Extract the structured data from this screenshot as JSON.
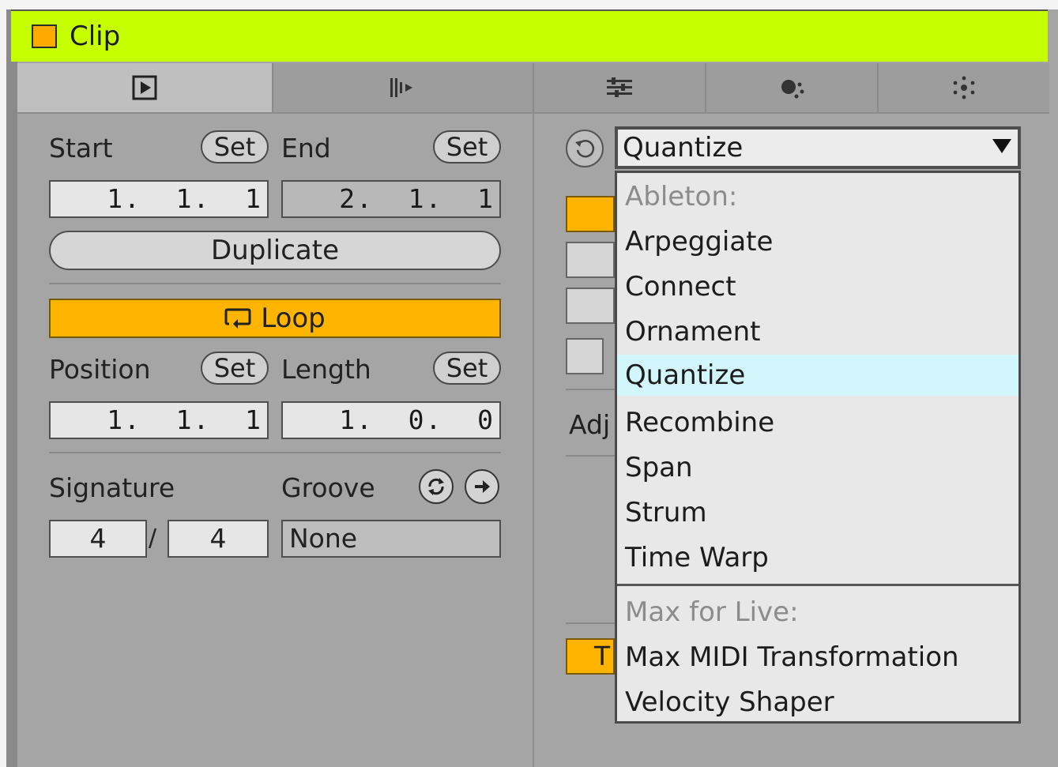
{
  "window": {
    "title": "Clip",
    "swatch_color": "#ffaa00",
    "title_bar_color": "#c5ff00"
  },
  "tabs": [
    {
      "icon": "play-box-icon",
      "active": true
    },
    {
      "icon": "audio-play-icon",
      "active": false
    },
    {
      "icon": "sliders-icon",
      "active": false
    },
    {
      "icon": "generators-icon",
      "active": false
    },
    {
      "icon": "transform-icon",
      "active": false
    }
  ],
  "left": {
    "start_label": "Start",
    "end_label": "End",
    "set_label": "Set",
    "start_value": "1.  1.  1",
    "end_value": "2.  1.  1",
    "duplicate_label": "Duplicate",
    "loop_label": "Loop",
    "position_label": "Position",
    "length_label": "Length",
    "position_value": "1.  1.  1",
    "length_value": "1.  0.  0",
    "signature_label": "Signature",
    "groove_label": "Groove",
    "sig_num": "4",
    "sig_slash": "/",
    "sig_den": "4",
    "groove_value": "None"
  },
  "right": {
    "device_select_value": "Quantize",
    "partial_label_adj": "Adj",
    "partial_button_t": "T",
    "dropdown": {
      "ableton_header": "Ableton:",
      "items": [
        "Arpeggiate",
        "Connect",
        "Ornament",
        "Quantize",
        "Recombine",
        "Span",
        "Strum",
        "Time Warp"
      ],
      "selected": "Quantize",
      "max_header": "Max for Live:",
      "max_items": [
        "Max MIDI Transformation",
        "Velocity Shaper"
      ]
    }
  },
  "colors": {
    "accent_orange": "#ffb400",
    "selected_row": "#d2f6fb",
    "lime": "#c5ff00"
  }
}
